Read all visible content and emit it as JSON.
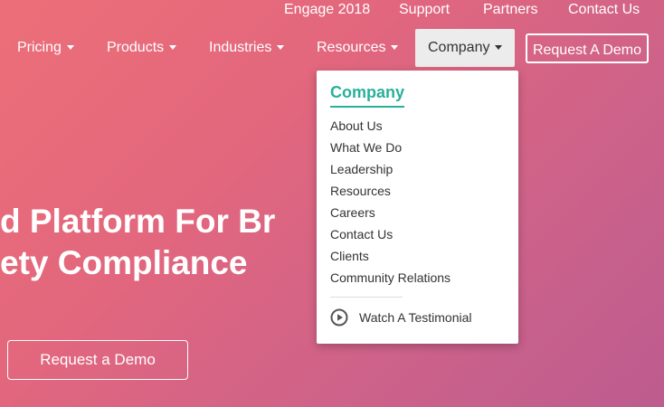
{
  "topbar": {
    "links": [
      "Engage 2018",
      "Support",
      "Partners",
      "Contact Us"
    ]
  },
  "nav": {
    "items": [
      "Pricing",
      "Products",
      "Industries",
      "Resources",
      "Company"
    ],
    "active": "Company",
    "cta": "Request A Demo"
  },
  "dropdown": {
    "heading": "Company",
    "items": [
      "About Us",
      "What We Do",
      "Leadership",
      "Resources",
      "Careers",
      "Contact Us",
      "Clients",
      "Community Relations"
    ],
    "testimonial": "Watch A Testimonial"
  },
  "hero": {
    "line1": "d Platform For Br",
    "line2": "ety Compliance",
    "cta": "Request a Demo"
  },
  "colors": {
    "accent": "#2ab09a",
    "gradient_start": "#ec6f78",
    "gradient_end": "#bd5c8f"
  }
}
